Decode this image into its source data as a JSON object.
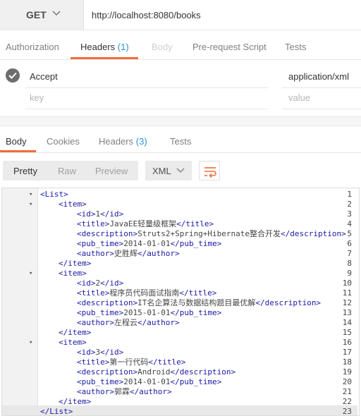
{
  "request": {
    "method": "GET",
    "url": "http://localhost:8080/books"
  },
  "request_tabs": [
    {
      "label": "Authorization"
    },
    {
      "label": "Headers",
      "count": "(1)"
    },
    {
      "label": "Body"
    },
    {
      "label": "Pre-request Script"
    },
    {
      "label": "Tests"
    }
  ],
  "headers": {
    "row": {
      "key": "Accept",
      "value": "application/xml",
      "enabled": true
    },
    "key_placeholder": "key",
    "value_placeholder": "value"
  },
  "response_tabs": [
    {
      "label": "Body"
    },
    {
      "label": "Cookies"
    },
    {
      "label": "Headers",
      "count": "(3)"
    },
    {
      "label": "Tests"
    }
  ],
  "view_modes": [
    "Pretty",
    "Raw",
    "Preview"
  ],
  "format": "XML",
  "icons": {
    "method_dropdown": "chevron-down-icon",
    "wrap": "wrap-lines-icon",
    "check": "check-icon"
  },
  "colors": {
    "accent": "#f26b3a",
    "count": "#2a8fd6",
    "tag": "#1a1aa6"
  },
  "code_lines": [
    {
      "n": "1",
      "fold": "▾",
      "indent": 0,
      "parts": [
        [
          "t",
          "<List>"
        ]
      ]
    },
    {
      "n": "2",
      "fold": "▾",
      "indent": 1,
      "parts": [
        [
          "t",
          "<item>"
        ]
      ]
    },
    {
      "n": "3",
      "fold": "",
      "indent": 2,
      "parts": [
        [
          "t",
          "<id>"
        ],
        [
          "x",
          "1"
        ],
        [
          "t",
          "</id>"
        ]
      ]
    },
    {
      "n": "4",
      "fold": "",
      "indent": 2,
      "parts": [
        [
          "t",
          "<title>"
        ],
        [
          "x",
          "JavaEE轻量级框架"
        ],
        [
          "t",
          "</title>"
        ]
      ]
    },
    {
      "n": "5",
      "fold": "",
      "indent": 2,
      "parts": [
        [
          "t",
          "<description>"
        ],
        [
          "x",
          "Struts2+Spring+Hibernate整合开发"
        ],
        [
          "t",
          "</description>"
        ]
      ]
    },
    {
      "n": "6",
      "fold": "",
      "indent": 2,
      "parts": [
        [
          "t",
          "<pub_time>"
        ],
        [
          "x",
          "2014-01-01"
        ],
        [
          "t",
          "</pub_time>"
        ]
      ]
    },
    {
      "n": "7",
      "fold": "",
      "indent": 2,
      "parts": [
        [
          "t",
          "<author>"
        ],
        [
          "x",
          "史胜辉"
        ],
        [
          "t",
          "</author>"
        ]
      ]
    },
    {
      "n": "8",
      "fold": "",
      "indent": 1,
      "parts": [
        [
          "t",
          "</item>"
        ]
      ]
    },
    {
      "n": "9",
      "fold": "▾",
      "indent": 1,
      "parts": [
        [
          "t",
          "<item>"
        ]
      ]
    },
    {
      "n": "10",
      "fold": "",
      "indent": 2,
      "parts": [
        [
          "t",
          "<id>"
        ],
        [
          "x",
          "2"
        ],
        [
          "t",
          "</id>"
        ]
      ]
    },
    {
      "n": "11",
      "fold": "",
      "indent": 2,
      "parts": [
        [
          "t",
          "<title>"
        ],
        [
          "x",
          "程序员代码面试指南"
        ],
        [
          "t",
          "</title>"
        ]
      ]
    },
    {
      "n": "12",
      "fold": "",
      "indent": 2,
      "parts": [
        [
          "t",
          "<description>"
        ],
        [
          "x",
          "IT名企算法与数据结构题目最优解"
        ],
        [
          "t",
          "</description>"
        ]
      ]
    },
    {
      "n": "13",
      "fold": "",
      "indent": 2,
      "parts": [
        [
          "t",
          "<pub_time>"
        ],
        [
          "x",
          "2015-01-01"
        ],
        [
          "t",
          "</pub_time>"
        ]
      ]
    },
    {
      "n": "14",
      "fold": "",
      "indent": 2,
      "parts": [
        [
          "t",
          "<author>"
        ],
        [
          "x",
          "左程云"
        ],
        [
          "t",
          "</author>"
        ]
      ]
    },
    {
      "n": "15",
      "fold": "",
      "indent": 1,
      "parts": [
        [
          "t",
          "</item>"
        ]
      ]
    },
    {
      "n": "16",
      "fold": "▾",
      "indent": 1,
      "parts": [
        [
          "t",
          "<item>"
        ]
      ]
    },
    {
      "n": "17",
      "fold": "",
      "indent": 2,
      "parts": [
        [
          "t",
          "<id>"
        ],
        [
          "x",
          "3"
        ],
        [
          "t",
          "</id>"
        ]
      ]
    },
    {
      "n": "18",
      "fold": "",
      "indent": 2,
      "parts": [
        [
          "t",
          "<title>"
        ],
        [
          "x",
          "第一行代码"
        ],
        [
          "t",
          "</title>"
        ]
      ]
    },
    {
      "n": "19",
      "fold": "",
      "indent": 2,
      "parts": [
        [
          "t",
          "<description>"
        ],
        [
          "x",
          "Android"
        ],
        [
          "t",
          "</description>"
        ]
      ]
    },
    {
      "n": "20",
      "fold": "",
      "indent": 2,
      "parts": [
        [
          "t",
          "<pub_time>"
        ],
        [
          "x",
          "2014-01-01"
        ],
        [
          "t",
          "</pub_time>"
        ]
      ]
    },
    {
      "n": "21",
      "fold": "",
      "indent": 2,
      "parts": [
        [
          "t",
          "<author>"
        ],
        [
          "x",
          "郭霖"
        ],
        [
          "t",
          "</author>"
        ]
      ]
    },
    {
      "n": "22",
      "fold": "",
      "indent": 1,
      "parts": [
        [
          "t",
          "</item>"
        ]
      ]
    },
    {
      "n": "23",
      "fold": "",
      "indent": 0,
      "parts": [
        [
          "t",
          "</List>"
        ]
      ]
    }
  ]
}
